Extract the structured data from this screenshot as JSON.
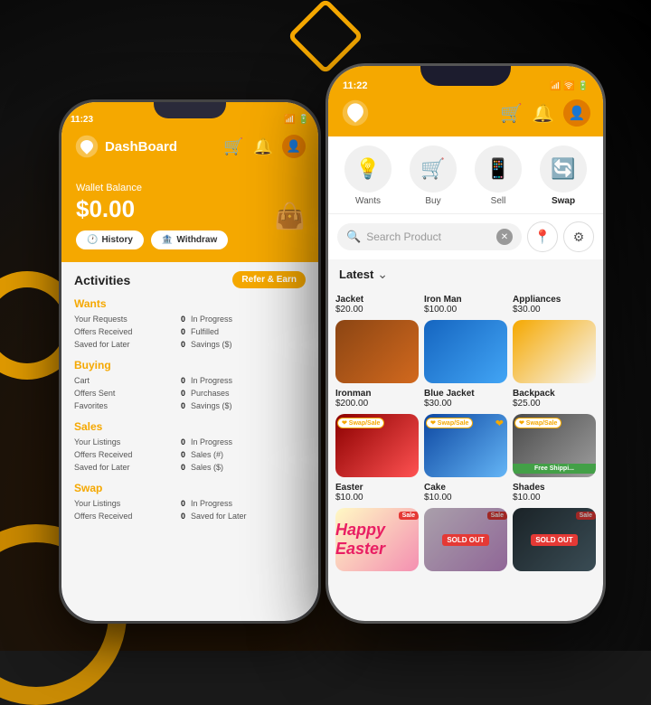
{
  "background": {
    "color": "#1a1a1a"
  },
  "back_phone": {
    "status_time": "11:23",
    "header": {
      "logo_text": "DashBoard",
      "cart_icon": "cart",
      "bell_icon": "bell"
    },
    "wallet": {
      "label": "Wallet Balance",
      "amount": "$0.00",
      "history_btn": "History",
      "withdraw_btn": "Withdraw"
    },
    "activities": {
      "title": "Activities",
      "refer_btn": "Refer & Earn",
      "groups": [
        {
          "title": "Wants",
          "rows": [
            {
              "label": "Your Requests",
              "value": "0",
              "status": "In Progress"
            },
            {
              "label": "Offers Received",
              "value": "0",
              "status": "Fulfilled"
            },
            {
              "label": "Saved for Later",
              "value": "0",
              "status": "Savings ($)"
            }
          ]
        },
        {
          "title": "Buying",
          "rows": [
            {
              "label": "Cart",
              "value": "0",
              "status": "In Progress"
            },
            {
              "label": "Offers Sent",
              "value": "0",
              "status": "Purchases"
            },
            {
              "label": "Favorites",
              "value": "0",
              "status": "Savings ($)"
            }
          ]
        },
        {
          "title": "Sales",
          "rows": [
            {
              "label": "Your Listings",
              "value": "0",
              "status": "In Progress"
            },
            {
              "label": "Offers Received",
              "value": "0",
              "status": "Sales (#)"
            },
            {
              "label": "Saved for Later",
              "value": "0",
              "status": "Sales ($)"
            }
          ]
        },
        {
          "title": "Swap",
          "rows": [
            {
              "label": "Your Listings",
              "value": "0",
              "status": "In Progress"
            },
            {
              "label": "Offers Received",
              "value": "0",
              "status": "Saved for Later"
            }
          ]
        }
      ]
    }
  },
  "front_phone": {
    "status_time": "11:22",
    "header": {
      "cart_icon": "🛒",
      "bell_icon": "🔔"
    },
    "nav_items": [
      {
        "icon": "💡",
        "label": "Wants",
        "active": false
      },
      {
        "icon": "🛒",
        "label": "Buy",
        "active": false
      },
      {
        "icon": "📱",
        "label": "Sell",
        "active": false
      },
      {
        "icon": "🔄",
        "label": "Swap",
        "active": true
      }
    ],
    "search": {
      "placeholder": "Search Product"
    },
    "latest_dropdown": "Latest",
    "products": [
      {
        "name": "Jacket",
        "price": "$20.00",
        "img_class": "img-jacket",
        "badge": "none",
        "heart": false,
        "sold_out": false,
        "free_shipping": false
      },
      {
        "name": "Iron Man",
        "price": "$100.00",
        "img_class": "img-ironman",
        "badge": "none",
        "heart": false,
        "sold_out": false,
        "free_shipping": false
      },
      {
        "name": "Appliances",
        "price": "$30.00",
        "img_class": "img-appliances",
        "badge": "none",
        "heart": false,
        "sold_out": false,
        "free_shipping": false
      },
      {
        "name": "Ironman",
        "price": "$200.00",
        "img_class": "img-ironman2",
        "badge": "swap",
        "heart": false,
        "sold_out": false,
        "free_shipping": false
      },
      {
        "name": "Blue Jacket",
        "price": "$30.00",
        "img_class": "img-bluejacket",
        "badge": "swap",
        "heart": true,
        "sold_out": false,
        "free_shipping": false
      },
      {
        "name": "Backpack",
        "price": "$25.00",
        "img_class": "img-backpack",
        "badge": "swap",
        "heart": false,
        "sold_out": false,
        "free_shipping": true
      },
      {
        "name": "Easter",
        "price": "$10.00",
        "img_class": "img-easter",
        "badge": "sale",
        "heart": false,
        "sold_out": false,
        "free_shipping": false
      },
      {
        "name": "Cake",
        "price": "$10.00",
        "img_class": "img-cake",
        "badge": "sale",
        "heart": false,
        "sold_out": true,
        "free_shipping": false
      },
      {
        "name": "Shades",
        "price": "$10.00",
        "img_class": "img-shades",
        "badge": "sale",
        "heart": false,
        "sold_out": true,
        "free_shipping": false
      }
    ]
  }
}
